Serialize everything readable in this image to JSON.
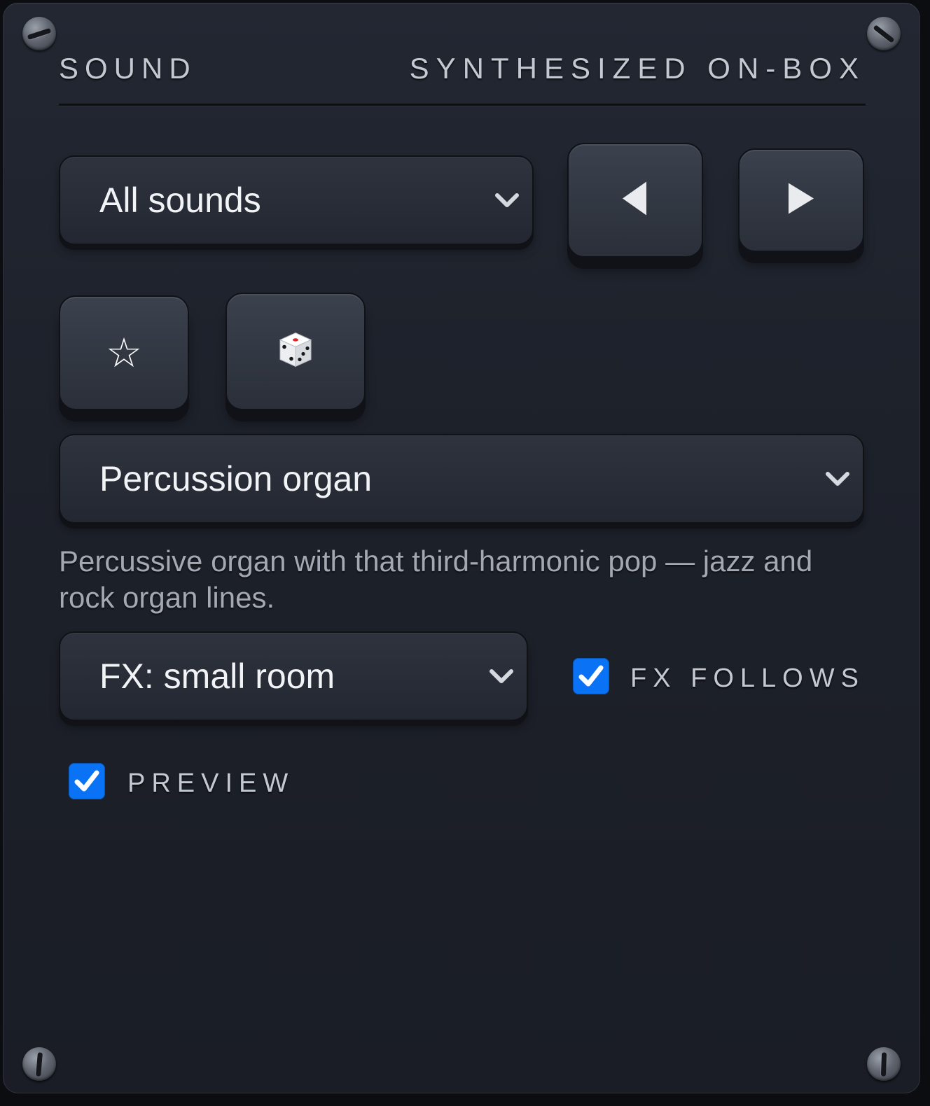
{
  "header": {
    "title": "SOUND",
    "subtitle": "SYNTHESIZED ON-BOX"
  },
  "category_select": {
    "value": "All sounds"
  },
  "navigation": {
    "prev_icon": "triangle-left-icon",
    "next_icon": "triangle-right-icon"
  },
  "actions": {
    "favorite_icon": "star-outline-icon",
    "favorite_glyph": "☆",
    "random_icon": "dice-icon"
  },
  "sound_select": {
    "value": "Percussion organ"
  },
  "description": "Percussive organ with that third-harmonic pop — jazz and rock organ lines.",
  "fx_select": {
    "value": "FX: small room"
  },
  "fx_follows": {
    "label": "FX FOLLOWS",
    "checked": true
  },
  "preview": {
    "label": "PREVIEW",
    "checked": true
  },
  "colors": {
    "panel": "#1d212a",
    "checkbox_accent": "#0a73f5",
    "text_primary": "#f1f3f6",
    "text_muted": "#a3a8b2"
  }
}
